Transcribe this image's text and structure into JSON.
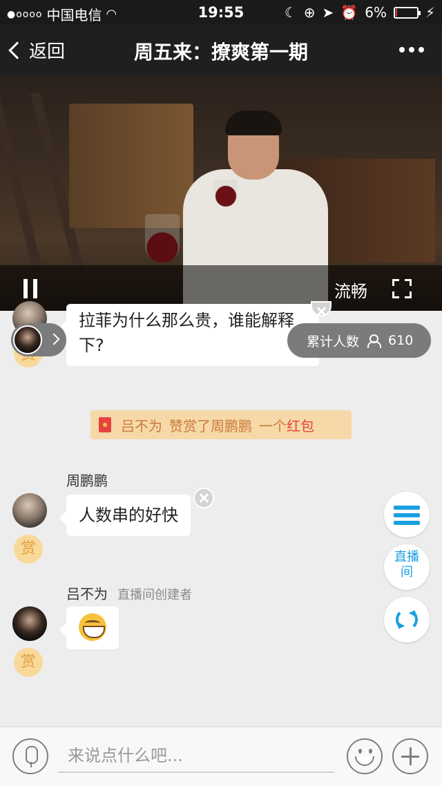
{
  "status_bar": {
    "signal": "●oooo",
    "carrier": "中国电信",
    "time": "19:55",
    "battery_percent": "6%",
    "battery_level": 0.06
  },
  "nav": {
    "back_label": "返回",
    "title": "周五来：撩爽第一期"
  },
  "video": {
    "quality_label": "流畅"
  },
  "stats": {
    "viewers_label": "累计人数",
    "viewers_count": "610"
  },
  "messages": [
    {
      "text": "拉菲为什么那么贵，谁能解释下?",
      "reward_label": "赏"
    },
    {
      "sender": "周鹏鹏",
      "text": "人数串的好快",
      "reward_label": "赏"
    },
    {
      "sender": "吕不为",
      "role": "直播间创建者",
      "emoji": "grinning-face",
      "reward_label": "赏"
    }
  ],
  "reward_notice": {
    "actor": "吕不为",
    "action": "赞赏了周鹏鹏",
    "amount": "一个",
    "item": "红包"
  },
  "side_buttons": {
    "live_room_label": "直播\n间"
  },
  "input": {
    "placeholder": "来说点什么吧..."
  },
  "colors": {
    "accent": "#1aa0e0",
    "reward_bg": "#f7d8a8",
    "reward_text": "#c97b3a",
    "red": "#e64340"
  }
}
